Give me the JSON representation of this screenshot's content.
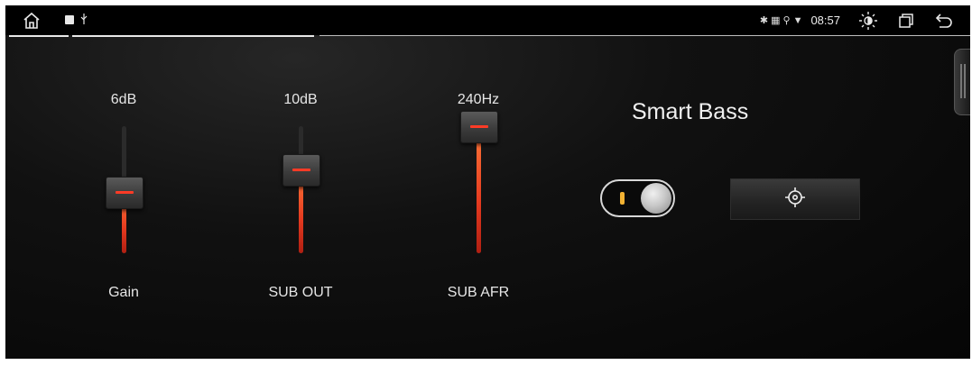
{
  "status_bar": {
    "time": "08:57",
    "left_icons": [
      "home-icon",
      "notification-square-icon",
      "usb-icon"
    ],
    "right_icons": [
      "bluetooth-icon",
      "signal-icon",
      "location-icon",
      "wifi-icon",
      "brightness-icon",
      "recent-apps-icon",
      "back-icon"
    ]
  },
  "sliders": [
    {
      "name": "gain",
      "label": "Gain",
      "value_text": "6dB",
      "level": 0.48
    },
    {
      "name": "sub-out",
      "label": "SUB OUT",
      "value_text": "10dB",
      "level": 0.66
    },
    {
      "name": "sub-afr",
      "label": "SUB AFR",
      "value_text": "240Hz",
      "level": 1.0
    }
  ],
  "smart_bass": {
    "title": "Smart Bass",
    "toggle_on": true,
    "button_icon": "crosshair-target-icon"
  },
  "colors": {
    "accent": "#ff3b26",
    "toggle_indicator": "#f2b233"
  }
}
